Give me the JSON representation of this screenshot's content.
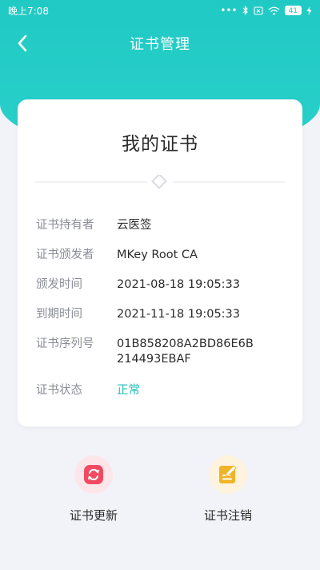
{
  "status_bar": {
    "time": "晚上7:08",
    "dots": "•••",
    "battery": "41"
  },
  "nav": {
    "title": "证书管理"
  },
  "card": {
    "title": "我的证书",
    "rows": [
      {
        "label": "证书持有者",
        "value": "云医签"
      },
      {
        "label": "证书颁发者",
        "value": "MKey Root CA"
      },
      {
        "label": "颁发时间",
        "value": "2021-08-18 19:05:33"
      },
      {
        "label": "到期时间",
        "value": "2021-11-18 19:05:33"
      },
      {
        "label": "证书序列号",
        "value": "01B858208A2BD86E6B214493EBAF"
      },
      {
        "label": "证书状态",
        "value": "正常"
      }
    ]
  },
  "actions": {
    "renew": {
      "label": "证书更新",
      "icon": "refresh-icon",
      "color": "#f04a63",
      "bg": "#fde6ea"
    },
    "revoke": {
      "label": "证书注销",
      "icon": "edit-document-icon",
      "color": "#f0b428",
      "bg": "#fdf3de"
    }
  },
  "colors": {
    "accent": "#21c9c4",
    "status_ok": "#20bfb4"
  }
}
